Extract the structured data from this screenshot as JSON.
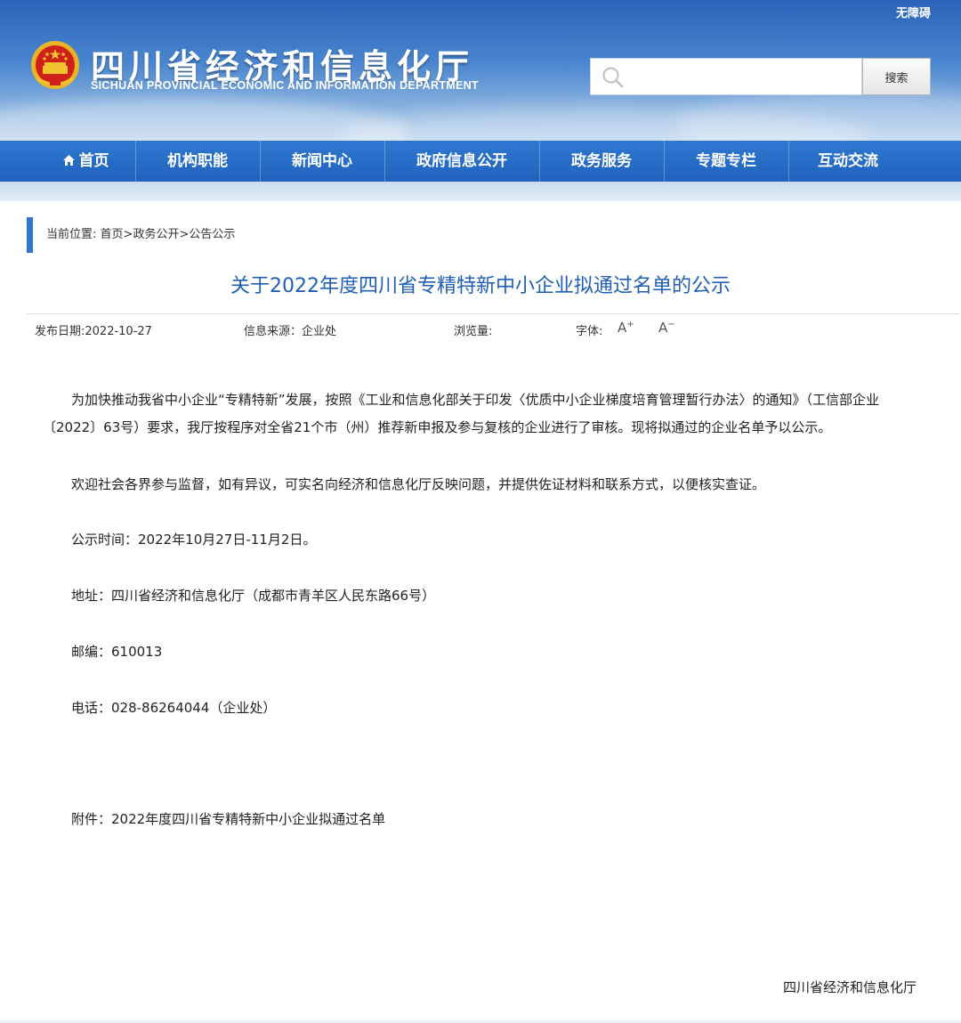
{
  "header": {
    "barrier_free": "无障碍",
    "title_cn": "四川省经济和信息化厅",
    "title_en": "SICHUAN PROVINCIAL ECONOMIC AND INFORMATION DEPARTMENT",
    "search": {
      "value": "",
      "placeholder": "",
      "button_label": "搜索"
    }
  },
  "nav": {
    "items": [
      {
        "label": "首页"
      },
      {
        "label": "机构职能"
      },
      {
        "label": "新闻中心"
      },
      {
        "label": "政府信息公开"
      },
      {
        "label": "政务服务"
      },
      {
        "label": "专题专栏"
      },
      {
        "label": "互动交流"
      }
    ]
  },
  "breadcrumb": {
    "prefix": "当前位置: ",
    "home": "首页",
    "sep1": ">",
    "section": "政务公开",
    "sep2": ">",
    "current": "公告公示"
  },
  "article": {
    "title": "关于2022年度四川省专精特新中小企业拟通过名单的公示",
    "meta": {
      "publish_date": "发布日期:2022-10-27",
      "source": "信息来源：企业处",
      "views": "浏览量:",
      "font_label": "字体:",
      "font_increase": "A",
      "font_decrease": "A"
    },
    "paragraphs": {
      "p1": "为加快推动我省中小企业“专精特新”发展，按照《工业和信息化部关于印发〈优质中小企业梯度培育管理暂行办法〉的通知》（工信部企业〔2022〕63号）要求，我厅按程序对全省21个市（州）推荐新申报及参与复核的企业进行了审核。现将拟通过的企业名单予以公示。",
      "p2": "欢迎社会各界参与监督，如有异议，可实名向经济和信息化厅反映问题，并提供佐证材料和联系方式，以便核实查证。",
      "p3": "公示时间：2022年10月27日-11月2日。",
      "p4": "地址：四川省经济和信息化厅（成都市青羊区人民东路66号）",
      "p5": "邮编：610013",
      "p6": "电话：028-86264044（企业处）",
      "attachment": "附件：2022年度四川省专精特新中小企业拟通过名单"
    },
    "signature": "四川省经济和信息化厅"
  },
  "colors": {
    "header_blue": "#2a63b8",
    "nav_blue": "#1f62bd",
    "title_blue": "#1f5fb5",
    "emblem_red": "#d0201a",
    "emblem_gold": "#f2c230"
  },
  "icons": {
    "emblem": "national-emblem-icon",
    "search": "search-icon",
    "home": "home-icon"
  }
}
